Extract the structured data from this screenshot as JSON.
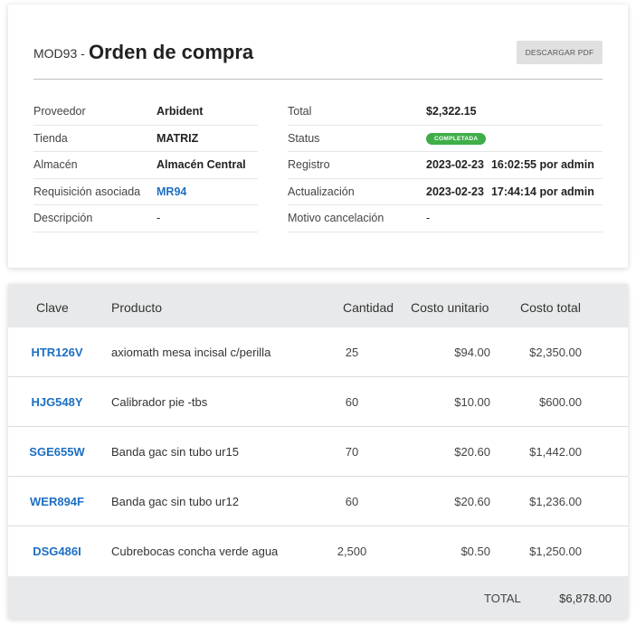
{
  "order": {
    "code": "MOD93 -",
    "title": "Orden de compra",
    "download_label": "DESCARGAR PDF"
  },
  "info_left": [
    {
      "label": "Proveedor",
      "value": "Arbident"
    },
    {
      "label": "Tienda",
      "value": "MATRIZ"
    },
    {
      "label": "Almacén",
      "value": "Almacén Central"
    },
    {
      "label": "Requisición asociada",
      "value": "MR94"
    },
    {
      "label": "Descripción",
      "value": "-"
    }
  ],
  "info_right": {
    "total": {
      "label": "Total",
      "value": "$2,322.15"
    },
    "status": {
      "label": "Status",
      "value": "COMPLETADA",
      "color": "#3fae49"
    },
    "registro": {
      "label": "Registro",
      "date": "2023-02-23",
      "time": "16:02:55 por admin"
    },
    "actualizacion": {
      "label": "Actualización",
      "date": "2023-02-23",
      "time": "17:44:14 por admin"
    },
    "motivo": {
      "label": "Motivo cancelación",
      "value": "-"
    }
  },
  "table": {
    "headers": {
      "clave": "Clave",
      "producto": "Producto",
      "cantidad": "Cantidad",
      "costo_unitario": "Costo unitario",
      "costo_total": "Costo total"
    },
    "rows": [
      {
        "clave": "HTR126V",
        "producto": "axiomath mesa incisal c/perilla",
        "cantidad": "25",
        "costo_unitario": "$94.00",
        "costo_total": "$2,350.00"
      },
      {
        "clave": "HJG548Y",
        "producto": "Calibrador pie -tbs",
        "cantidad": "60",
        "costo_unitario": "$10.00",
        "costo_total": "$600.00"
      },
      {
        "clave": "SGE655W",
        "producto": "Banda gac sin tubo ur15",
        "cantidad": "70",
        "costo_unitario": "$20.60",
        "costo_total": "$1,442.00"
      },
      {
        "clave": "WER894F",
        "producto": "Banda gac sin tubo ur12",
        "cantidad": "60",
        "costo_unitario": "$20.60",
        "costo_total": "$1,236.00"
      },
      {
        "clave": "DSG486I",
        "producto": "Cubrebocas concha verde agua",
        "cantidad": "2,500",
        "costo_unitario": "$0.50",
        "costo_total": "$1,250.00"
      }
    ],
    "footer": {
      "label": "TOTAL",
      "value": "$6,878.00"
    }
  },
  "colors": {
    "link": "#1e6fc1",
    "status_completed": "#3fae49",
    "header_bg": "#e8e9ea"
  }
}
